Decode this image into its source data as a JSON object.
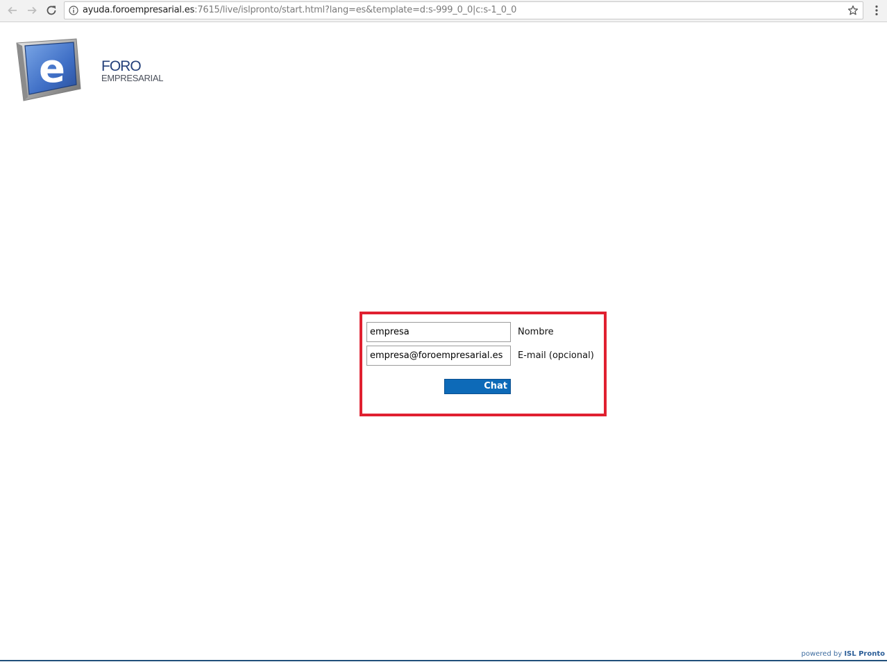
{
  "browser": {
    "url_host": "ayuda.foroempresarial.es",
    "url_rest": ":7615/live/islpronto/start.html?lang=es&template=d:s-999_0_0|c:s-1_0_0"
  },
  "brand": {
    "logo_letter": "e",
    "line1": "FORO",
    "line2": "EMPRESARIAL"
  },
  "form": {
    "name_value": "empresa",
    "name_label": "Nombre",
    "email_value": "empresa@foroempresarial.es",
    "email_label": "E-mail (opcional)",
    "chat_button": "Chat"
  },
  "footer": {
    "powered_prefix": "powered by",
    "powered_brand": "ISL Pronto"
  },
  "colors": {
    "highlight_border": "#e02030",
    "button_blue": "#0d6ab8",
    "brand_navy": "#24407a"
  },
  "icons": [
    "back-arrow-icon",
    "forward-arrow-icon",
    "reload-icon",
    "info-icon",
    "star-icon",
    "menu-icon"
  ]
}
